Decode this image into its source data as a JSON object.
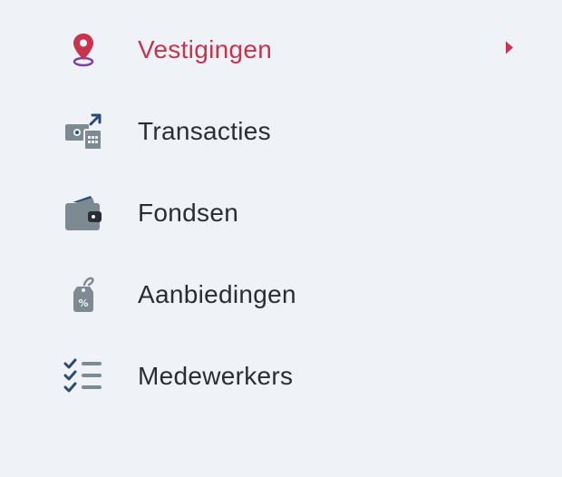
{
  "menu": {
    "items": [
      {
        "label": "Vestigingen",
        "icon": "location-pin-icon",
        "active": true
      },
      {
        "label": "Transacties",
        "icon": "transactions-icon",
        "active": false
      },
      {
        "label": "Fondsen",
        "icon": "wallet-icon",
        "active": false
      },
      {
        "label": "Aanbiedingen",
        "icon": "discount-tag-icon",
        "active": false
      },
      {
        "label": "Medewerkers",
        "icon": "checklist-icon",
        "active": false
      }
    ]
  },
  "colors": {
    "active": "#c8334d",
    "text": "#2a2d33",
    "icon_gray": "#7e8a92",
    "icon_navy": "#2c4a78",
    "pin_purple": "#7b3fb0",
    "background": "#eff2f6"
  }
}
